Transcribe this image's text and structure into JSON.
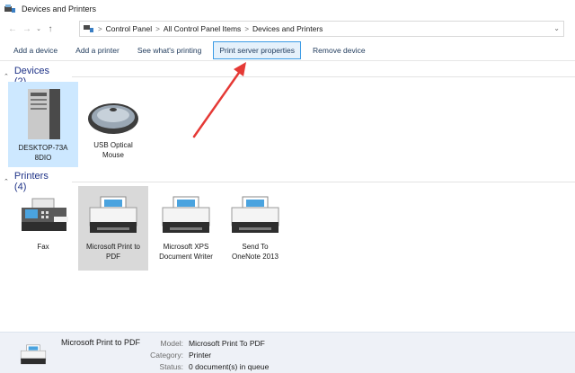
{
  "window": {
    "title": "Devices and Printers"
  },
  "address": {
    "segments": [
      "Control Panel",
      "All Control Panel Items",
      "Devices and Printers"
    ],
    "separator": ">"
  },
  "commands": [
    {
      "label": "Add a device"
    },
    {
      "label": "Add a printer"
    },
    {
      "label": "See what's printing"
    },
    {
      "label": "Print server properties"
    },
    {
      "label": "Remove device"
    }
  ],
  "groups": {
    "devices": {
      "title": "Devices (2)"
    },
    "printers": {
      "title": "Printers (4)"
    }
  },
  "devices": [
    {
      "label": "DESKTOP-73A8DIO",
      "icon": "computer-tower-icon"
    },
    {
      "label": "USB Optical Mouse",
      "icon": "mouse-icon"
    }
  ],
  "printers": [
    {
      "label": "Fax",
      "icon": "fax-icon"
    },
    {
      "label": "Microsoft Print to PDF",
      "icon": "printer-icon"
    },
    {
      "label": "Microsoft XPS Document Writer",
      "icon": "printer-icon"
    },
    {
      "label": "Send To OneNote 2013",
      "icon": "printer-icon"
    }
  ],
  "details": {
    "name": "Microsoft Print to PDF",
    "rows": [
      {
        "key": "Model:",
        "value": "Microsoft Print To PDF"
      },
      {
        "key": "Category:",
        "value": "Printer"
      },
      {
        "key": "Status:",
        "value": "0 document(s) in queue"
      }
    ]
  },
  "colors": {
    "annotation_arrow": "#e53935",
    "selection": "#cde8ff",
    "link_text": "#1e395b",
    "group_title": "#1e3287"
  }
}
